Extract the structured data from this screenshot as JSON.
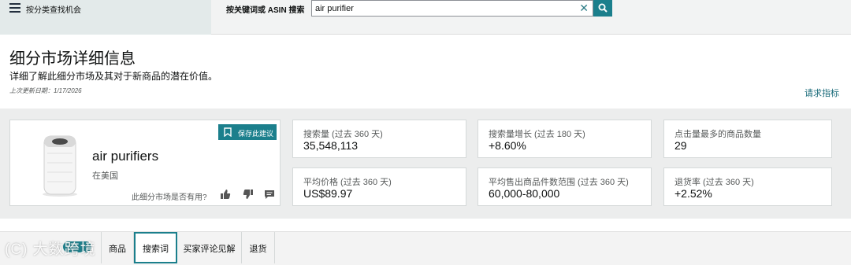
{
  "topbar": {
    "menu_label": "按分类查找机会",
    "search_label": "按关键词或 ASIN 搜索",
    "search_value": "air purifier"
  },
  "header": {
    "title": "细分市场详细信息",
    "description": "详细了解此细分市场及其对于新商品的潜在价值。",
    "updated": "上次更新日期：1/17/2026",
    "request_link": "请求指标"
  },
  "product": {
    "name": "air purifiers",
    "market": "在美国",
    "save_label": "保存此建议",
    "feedback_question": "此细分市场是否有用?"
  },
  "metrics": [
    {
      "label": "搜索量 (过去 360 天)",
      "value": "35,548,113"
    },
    {
      "label": "搜索量增长 (过去 180 天)",
      "value": "+8.60%"
    },
    {
      "label": "点击量最多的商品数量",
      "value": "29"
    },
    {
      "label": "平均价格 (过去 360 天)",
      "value": "US$89.97"
    },
    {
      "label": "平均售出商品件数范围 (过去 360 天)",
      "value": "60,000-80,000"
    },
    {
      "label": "退货率 (过去 360 天)",
      "value": "+2.52%"
    }
  ],
  "tabs": [
    {
      "label": "商品"
    },
    {
      "label": "搜索词"
    },
    {
      "label": "买家评论见解"
    },
    {
      "label": "退货"
    }
  ],
  "watermark": "(C) 大数跨境",
  "colors": {
    "accent": "#1b7f8c",
    "link": "#1a6b7a",
    "panel": "#eceded"
  }
}
